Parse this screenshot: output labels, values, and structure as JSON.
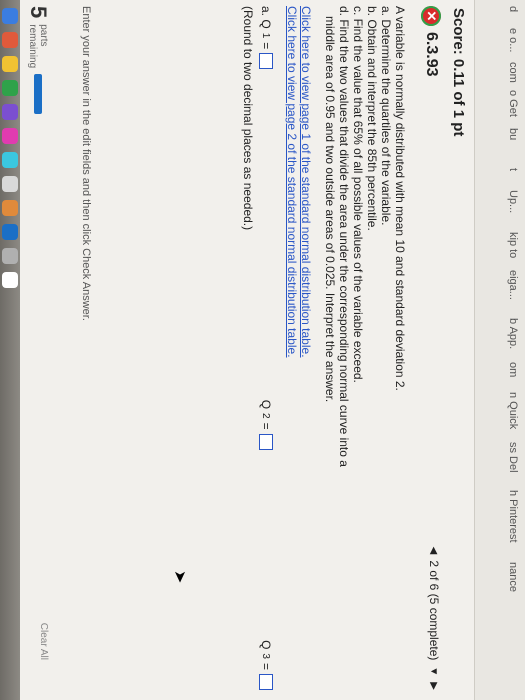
{
  "sidebar": {
    "items": [
      "d",
      "e o...",
      "com",
      "o Get",
      "bu",
      "t",
      "Up...",
      "kip to",
      "eiga...",
      "b App.",
      "om",
      "n Quick",
      "ss Del",
      "h Pinterest",
      "nance"
    ]
  },
  "score": {
    "text": "Score: 0.11 of 1 pt"
  },
  "question": {
    "number": "6.3.93",
    "status_icon": "x-icon"
  },
  "nav": {
    "prev_icon": "triangle-left-icon",
    "position": "2 of 6 (5 complete)",
    "dropdown_icon": "triangle-down-icon",
    "next_icon": "triangle-right-icon"
  },
  "problem": {
    "lines": [
      "A variable is normally distributed with mean 10 and standard deviation 2.",
      "a. Determine the quartiles of the variable.",
      "b. Obtain and interpret the 85th percentile.",
      "c. Find the value that 65% of all possible values of the variable exceed.",
      "d. Find the two values that divide the area under the corresponding normal curve into a",
      "   middle area of 0.95 and two outside areas of 0.025. Interpret the answer."
    ],
    "link1": "Click here to view page 1 of the standard normal distribution table.",
    "link2": "Click here to view page 2 of the standard normal distribution table."
  },
  "answers": {
    "part_a_label": "a. Q",
    "q1_sub": "1",
    "q2_label": "Q",
    "q2_sub": "2",
    "q3_label": "Q",
    "q3_sub": "3",
    "equals": "=",
    "note": "(Round to two decimal places as needed.)"
  },
  "footer": {
    "instruction": "Enter your answer in the edit fields and then click Check Answer.",
    "parts_number": "5",
    "parts_label": "parts",
    "remaining_label": "remaining",
    "clear_all": "Clear All"
  }
}
